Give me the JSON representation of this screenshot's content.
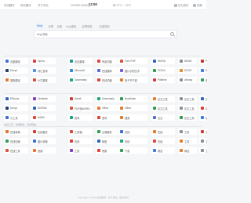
{
  "topbar": {
    "left_links": [
      "在线翻译",
      "网页翻译",
      "关于本站"
    ],
    "time": "12:58",
    "date": "2020年11月08日",
    "weather": "晴 17°C ~ 13°C",
    "right_links": [
      "设为首页",
      "收藏"
    ]
  },
  "search": {
    "tabs": [
      "bing",
      "谷歌",
      "百度",
      "bing搜索",
      "谷歌搜索",
      "百度搜索"
    ],
    "active_tab": 0,
    "placeholder": "bing 搜索"
  },
  "sections": [
    {
      "title": "",
      "rows": [
        [
          {
            "label": "百度翻译",
            "color": "#3b6fd8"
          },
          {
            "label": "Opera",
            "color": "#e03a3a"
          },
          {
            "label": "必应翻译",
            "color": "#1a9a8e"
          },
          {
            "label": "有道词典",
            "color": "#e0443a"
          },
          {
            "label": "Free PDF",
            "color": "#d8543a"
          },
          {
            "label": "WORD",
            "color": "#2f64c2"
          },
          {
            "label": "NEWS",
            "color": "#888c94"
          },
          {
            "label": "PDF",
            "color": "#c0392b"
          }
        ],
        [
          {
            "label": "DeepL",
            "color": "#223c6b"
          },
          {
            "label": "词汇查询",
            "color": "#4a90e2"
          },
          {
            "label": "Microsoft",
            "color": "#2a8ad4"
          },
          {
            "label": "在线翻译",
            "color": "#5a6cd8"
          },
          {
            "label": "图片识别文字",
            "color": "#7b5ad8"
          },
          {
            "label": "GOGA",
            "color": "#2f9e52"
          },
          {
            "label": "DOOC",
            "color": "#e58a2a"
          },
          {
            "label": "Docs",
            "color": "#3d7be0"
          }
        ],
        [
          {
            "label": "搜狗翻译",
            "color": "#e8742c"
          },
          {
            "label": "小牛翻译",
            "color": "#e04a3a"
          },
          {
            "label": "Grammarly",
            "color": "#19a87c"
          },
          {
            "label": "在线词典",
            "color": "#e0443a"
          },
          {
            "label": "电子书下载",
            "color": "#e27d2c"
          },
          {
            "label": "Pdfdrive",
            "color": "#d83a3a"
          },
          {
            "label": "zlibrary",
            "color": "#8a8f98"
          },
          {
            "label": "电子书",
            "color": "#2f9e52"
          }
        ]
      ]
    },
    {
      "title": "",
      "rows": [
        [
          {
            "label": "ESbook",
            "color": "#2f64c2"
          },
          {
            "label": "OneNote",
            "color": "#8a3ac2"
          },
          {
            "label": "Gmail",
            "color": "#d83a3a"
          },
          {
            "label": "Grammarly",
            "color": "#19a87c"
          },
          {
            "label": "BookNote",
            "color": "#2f9e52"
          },
          {
            "label": "论文工具",
            "color": "#e27d2c"
          },
          {
            "label": "论文工具",
            "color": "#8a8f98"
          },
          {
            "label": "论文",
            "color": "#2f64c2"
          }
        ],
        [
          {
            "label": "DeepL",
            "color": "#223c6b"
          },
          {
            "label": "WORD2",
            "color": "#2f64c2"
          },
          {
            "label": "PDF转WORD",
            "color": "#d8543a"
          },
          {
            "label": "Office",
            "color": "#e8742c"
          },
          {
            "label": "Office",
            "color": "#e27d2c"
          },
          {
            "label": "论文工具",
            "color": "#2f9e52"
          },
          {
            "label": "论文工具",
            "color": "#8a8f98"
          },
          {
            "label": "论文",
            "color": "#e03a3a"
          }
        ],
        [
          {
            "label": "小工具",
            "color": "#3b6fd8"
          },
          {
            "label": "BAND",
            "color": "#e04a3a"
          },
          {
            "label": "查询",
            "color": "#19a87c"
          },
          {
            "label": "查询",
            "color": "#e0443a"
          },
          {
            "label": "搜索",
            "color": "#e27d2c"
          },
          {
            "label": "论文",
            "color": "#5a6cd8"
          },
          {
            "label": "论文工具",
            "color": "#2f9e52"
          },
          {
            "label": "论文",
            "color": "#3d7be0"
          }
        ]
      ]
    },
    {
      "title": "在线工具 · 常用网址 · 实用网站",
      "rows": [
        [
          {
            "label": "在线转换",
            "color": "#e8742c"
          },
          {
            "label": "在线格式",
            "color": "#d83a3a"
          },
          {
            "label": "工具箱",
            "color": "#e0443a"
          },
          {
            "label": "云端服务",
            "color": "#2f9e52"
          },
          {
            "label": "在线",
            "color": "#3b6fd8"
          },
          {
            "label": "在线",
            "color": "#e27d2c"
          },
          {
            "label": "工具",
            "color": "#8a8f98"
          },
          {
            "label": "工具",
            "color": "#d83a3a"
          }
        ],
        [
          {
            "label": "在线压缩",
            "color": "#2f9e52"
          },
          {
            "label": "图片转换",
            "color": "#3b6fd8"
          },
          {
            "label": "在线",
            "color": "#e03a3a"
          },
          {
            "label": "网盘",
            "color": "#2f64c2"
          },
          {
            "label": "在线",
            "color": "#19a87c"
          },
          {
            "label": "在线",
            "color": "#e0443a"
          },
          {
            "label": "工具",
            "color": "#e27d2c"
          },
          {
            "label": "工具",
            "color": "#8a8f98"
          }
        ],
        [
          {
            "label": "在线工具",
            "color": "#d8543a"
          },
          {
            "label": "音频",
            "color": "#e8742c"
          },
          {
            "label": "工具",
            "color": "#8a3ac2"
          },
          {
            "label": "视频",
            "color": "#e0443a"
          },
          {
            "label": "下载",
            "color": "#2f9e52"
          },
          {
            "label": "网站",
            "color": "#3d7be0"
          },
          {
            "label": "网站",
            "color": "#e27d2c"
          },
          {
            "label": "工具",
            "color": "#8a8f98"
          }
        ]
      ]
    }
  ],
  "footer": "Copyright © 2020 在线翻译 · 关于本站 · 联系我们"
}
